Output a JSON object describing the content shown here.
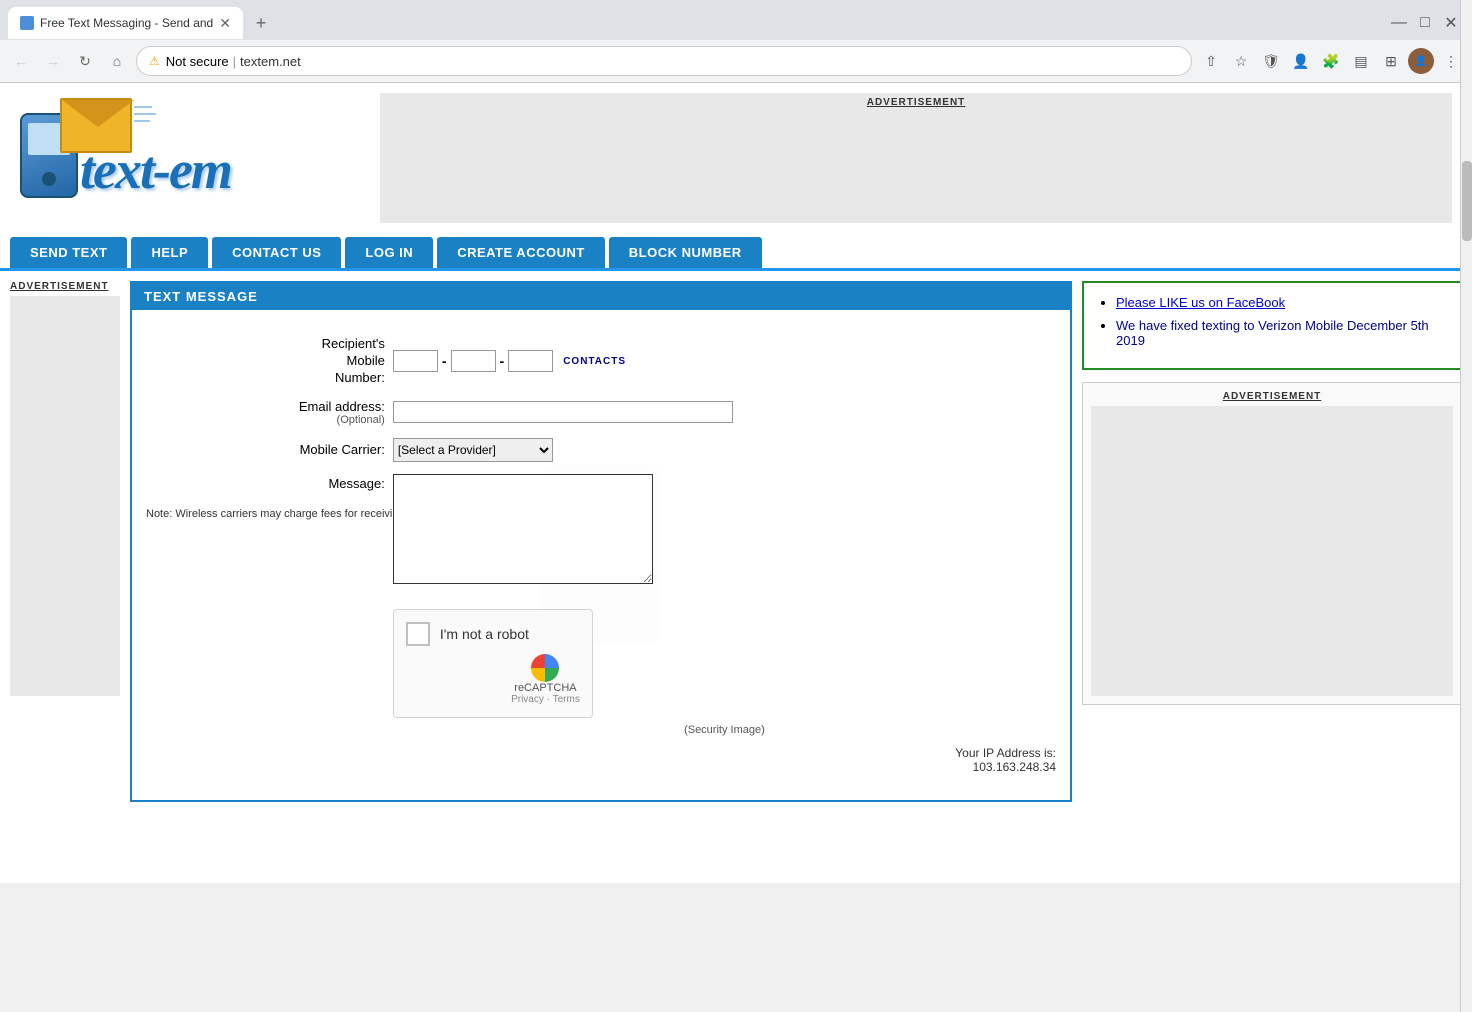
{
  "browser": {
    "tab_title": "Free Text Messaging - Send and",
    "url_warning": "Not secure",
    "url_domain": "textem.net",
    "new_tab_label": "+"
  },
  "header": {
    "ad_label": "ADVERTISEMENT",
    "logo_text": "text-em"
  },
  "nav": {
    "items": [
      {
        "label": "SEND TEXT",
        "id": "send-text"
      },
      {
        "label": "HELP",
        "id": "help"
      },
      {
        "label": "CONTACT US",
        "id": "contact-us"
      },
      {
        "label": "LOG IN",
        "id": "log-in"
      },
      {
        "label": "CREATE ACCOUNT",
        "id": "create-account"
      },
      {
        "label": "BLOCK NUMBER",
        "id": "block-number"
      }
    ]
  },
  "sidebar_left": {
    "ad_label": "ADVERTISEMENT"
  },
  "form": {
    "panel_title": "TEXT MESSAGE",
    "recipient_label": "Recipient's",
    "mobile_label": "Mobile",
    "number_label": "Number:",
    "contacts_label": "CONTACTS",
    "email_label": "Email address:",
    "optional_label": "(Optional)",
    "carrier_label": "Mobile Carrier:",
    "carrier_default": "[Select a Provider]",
    "message_label": "Message:",
    "note_text": "Note: Wireless carriers may charge fees for receiving messages. Regular text message rates apply.",
    "captcha_label": "I'm not a robot",
    "recaptcha_label": "reCAPTCHA",
    "privacy_label": "Privacy",
    "terms_label": "Terms",
    "privacy_separator": "·",
    "security_label": "(Security Image)",
    "ip_label": "Your IP Address is:",
    "ip_value": "103.163.248.34"
  },
  "sidebar_right": {
    "fb_link": "Please LIKE us on FaceBook",
    "verizon_text": "We have fixed texting to Verizon Mobile December 5th 2019",
    "ad_label": "ADVERTISEMENT"
  },
  "window_controls": {
    "minimize": "—",
    "maximize": "□",
    "close": "✕"
  }
}
